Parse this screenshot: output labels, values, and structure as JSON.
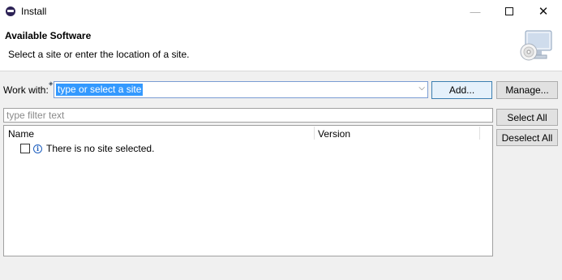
{
  "window": {
    "title": "Install",
    "minimize_glyph": "—",
    "maximize_icon": "maximize-icon",
    "close_glyph": "✕"
  },
  "header": {
    "title": "Available Software",
    "description": "Select a site or enter the location of a site."
  },
  "work_with": {
    "label": "Work with:",
    "value": "type or select a site",
    "dropdown_glyph": "⌵"
  },
  "buttons": {
    "add": "Add...",
    "manage": "Manage...",
    "select_all": "Select All",
    "deselect_all": "Deselect All"
  },
  "filter": {
    "placeholder": "type filter text"
  },
  "table": {
    "columns": [
      "Name",
      "Version"
    ],
    "rows": [
      {
        "checked": false,
        "icon": "info-icon",
        "text": "There is no site selected."
      }
    ]
  },
  "colors": {
    "selection": "#3399ff",
    "focus_border": "#3c7fb1",
    "info_icon": "#1e5fbf"
  }
}
